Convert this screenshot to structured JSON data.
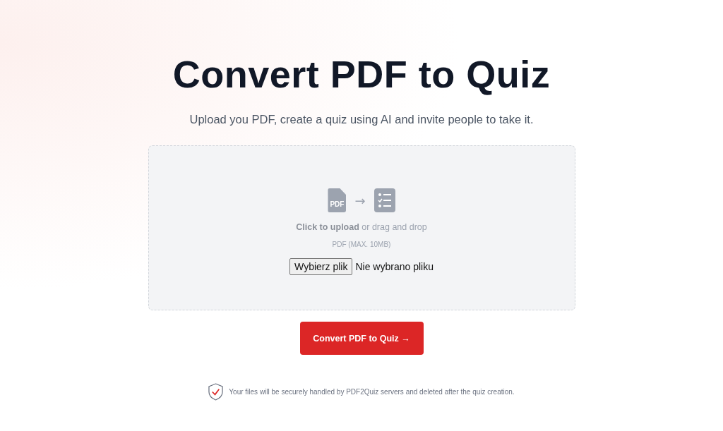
{
  "title": "Convert PDF to Quiz",
  "subtitle": "Upload you PDF, create a quiz using AI and invite people to take it.",
  "dropzone": {
    "file_icon_label": "PDF",
    "arrow": "→",
    "prompt": "**Click to upload** or drag and drop",
    "limit": "PDF (MAX. 10MB)",
    "choose_button": "Wybierz plik",
    "file_status": "Nie wybrano pliku"
  },
  "submit_button": "Convert PDF to Quiz →",
  "security_note": "Your files will be securely handled by PDF2Quiz servers and deleted after the quiz creation."
}
